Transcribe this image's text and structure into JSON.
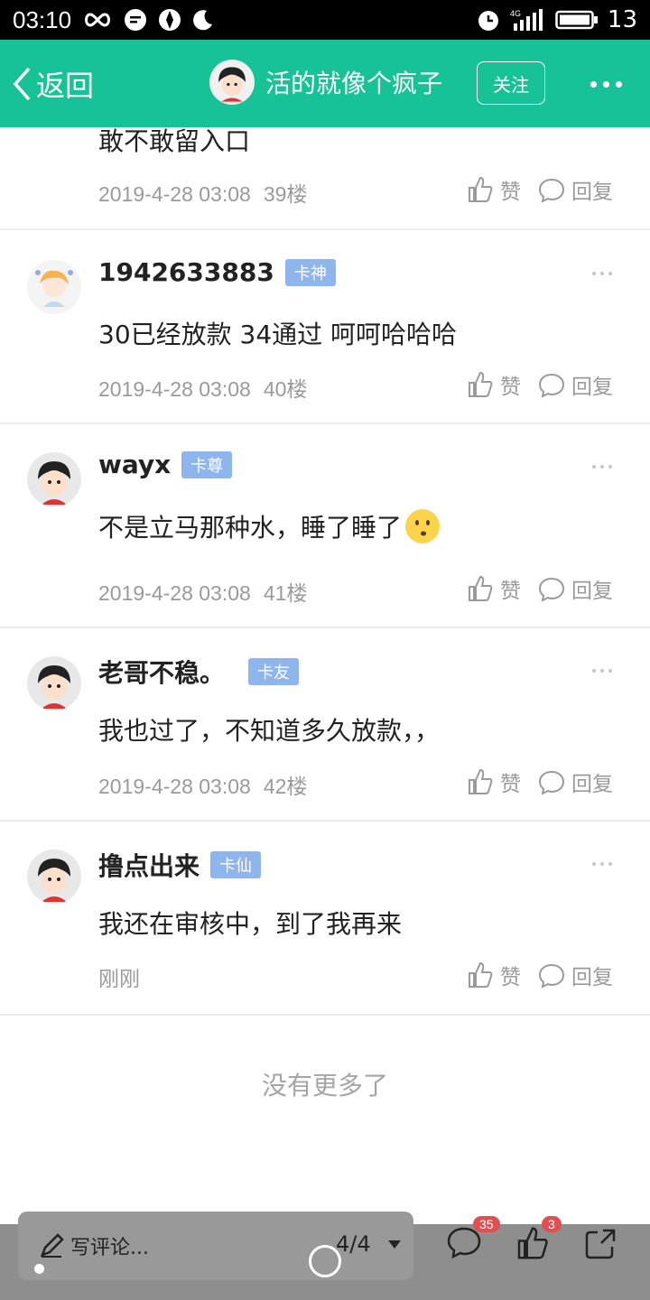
{
  "status": {
    "time": "03:10",
    "battery": "13",
    "network": "4G"
  },
  "nav": {
    "back": "返回",
    "title": "活的就像个疯子",
    "follow": "关注"
  },
  "posts": [
    {
      "text": "敢不敢留入口",
      "date": "2019-4-28 03:08",
      "floor": "39楼",
      "like": "赞",
      "reply": "回复"
    },
    {
      "user": "1942633883",
      "badge": "卡神",
      "text": "30已经放款 34通过 呵呵哈哈哈",
      "date": "2019-4-28 03:08",
      "floor": "40楼",
      "like": "赞",
      "reply": "回复"
    },
    {
      "user": "wayx",
      "badge": "卡尊",
      "text": "不是立马那种水，睡了睡了",
      "date": "2019-4-28 03:08",
      "floor": "41楼",
      "like": "赞",
      "reply": "回复"
    },
    {
      "user": "老哥不稳。",
      "badge": "卡友",
      "text": "我也过了，不知道多久放款，，",
      "date": "2019-4-28 03:08",
      "floor": "42楼",
      "like": "赞",
      "reply": "回复"
    },
    {
      "user": "撸点出来",
      "badge": "卡仙",
      "text": "我还在审核中，到了我再来",
      "date": "刚刚",
      "floor": "",
      "like": "赞",
      "reply": "回复"
    }
  ],
  "footer": {
    "no_more": "没有更多了"
  },
  "bottom": {
    "placeholder": "写评论...",
    "page": "4/4",
    "comment_count": "35",
    "like_count": "3"
  },
  "colors": {
    "brand": "#17c296",
    "badge": "#8fb6ec",
    "count_badge": "#e05050"
  }
}
